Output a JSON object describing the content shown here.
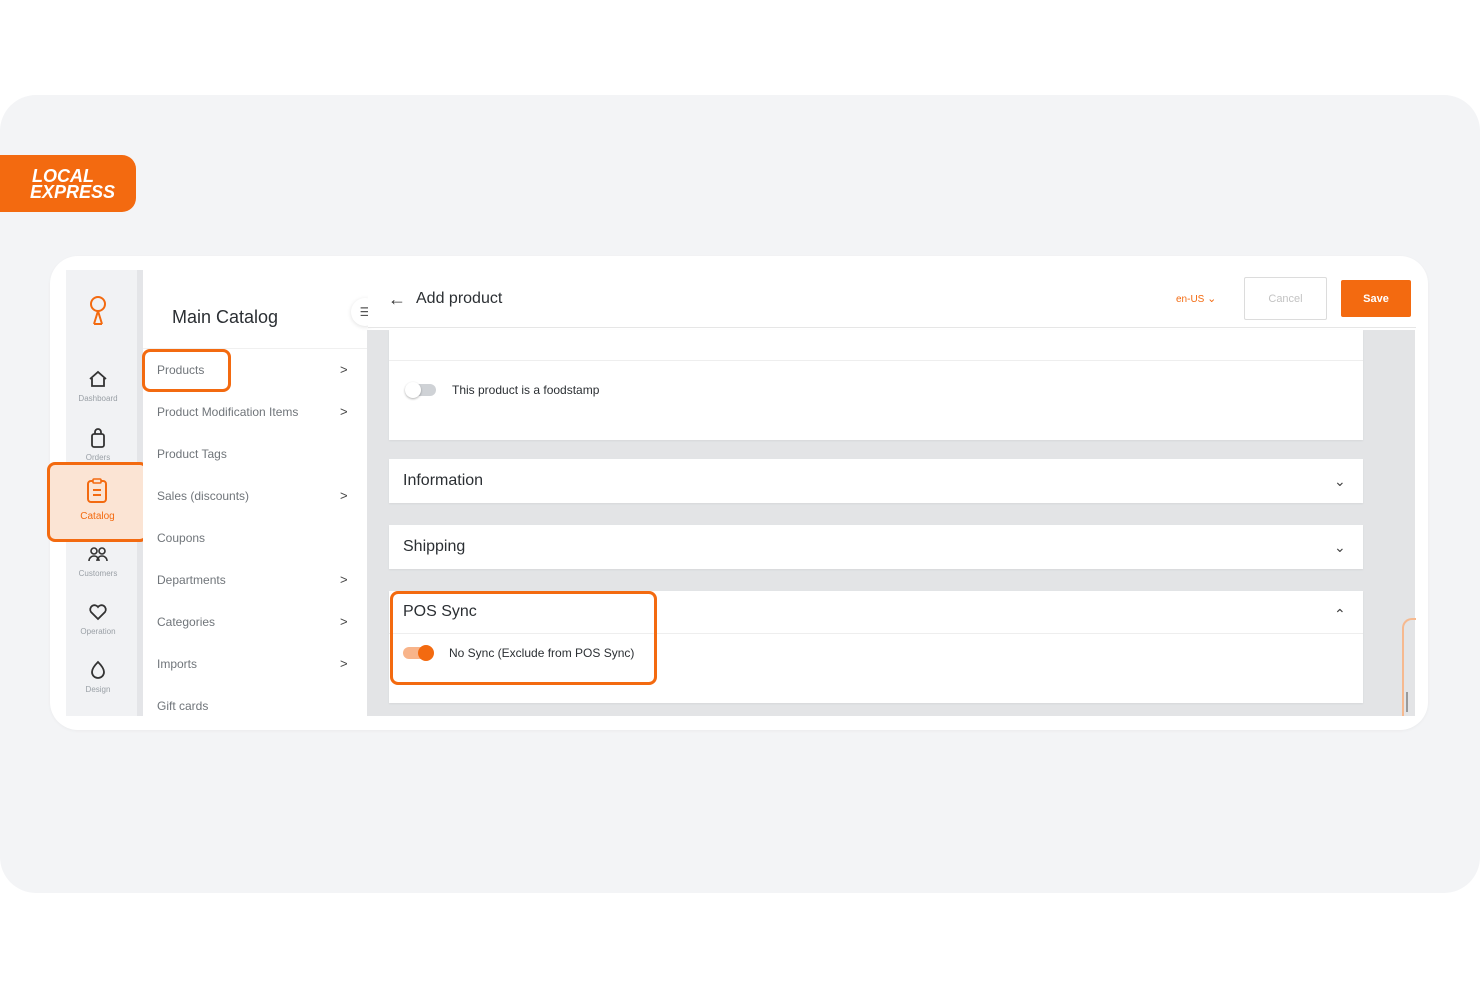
{
  "brand": {
    "line1": "LOCAL",
    "line2": "EXPRESS"
  },
  "rail": {
    "items": [
      {
        "label": "Dashboard",
        "icon": "home-icon"
      },
      {
        "label": "Orders",
        "icon": "shopping-bag-icon"
      },
      {
        "label": "Catalog",
        "icon": "clipboard-icon"
      },
      {
        "label": "Customers",
        "icon": "users-icon"
      },
      {
        "label": "Operation",
        "icon": "heart-hand-icon"
      },
      {
        "label": "Design",
        "icon": "palette-icon"
      }
    ]
  },
  "catalog": {
    "title": "Main Catalog",
    "items": [
      {
        "label": "Products",
        "chevron": ">"
      },
      {
        "label": "Product Modification Items",
        "chevron": ">"
      },
      {
        "label": "Product Tags",
        "chevron": ""
      },
      {
        "label": "Sales (discounts)",
        "chevron": ">"
      },
      {
        "label": "Coupons",
        "chevron": ""
      },
      {
        "label": "Departments",
        "chevron": ">"
      },
      {
        "label": "Categories",
        "chevron": ">"
      },
      {
        "label": "Imports",
        "chevron": ">"
      },
      {
        "label": "Gift cards",
        "chevron": ""
      }
    ]
  },
  "header": {
    "title": "Add product",
    "locale": "en-US",
    "cancel_label": "Cancel",
    "save_label": "Save"
  },
  "sections": {
    "foodstamp": {
      "label": "This product is a foodstamp",
      "enabled": false
    },
    "information": {
      "title": "Information"
    },
    "shipping": {
      "title": "Shipping"
    },
    "pos_sync": {
      "title": "POS Sync",
      "option_label": "No Sync (Exclude from POS Sync)",
      "enabled": true
    }
  },
  "colors": {
    "accent": "#f36a10",
    "highlight_fill": "#fbe4d4"
  }
}
